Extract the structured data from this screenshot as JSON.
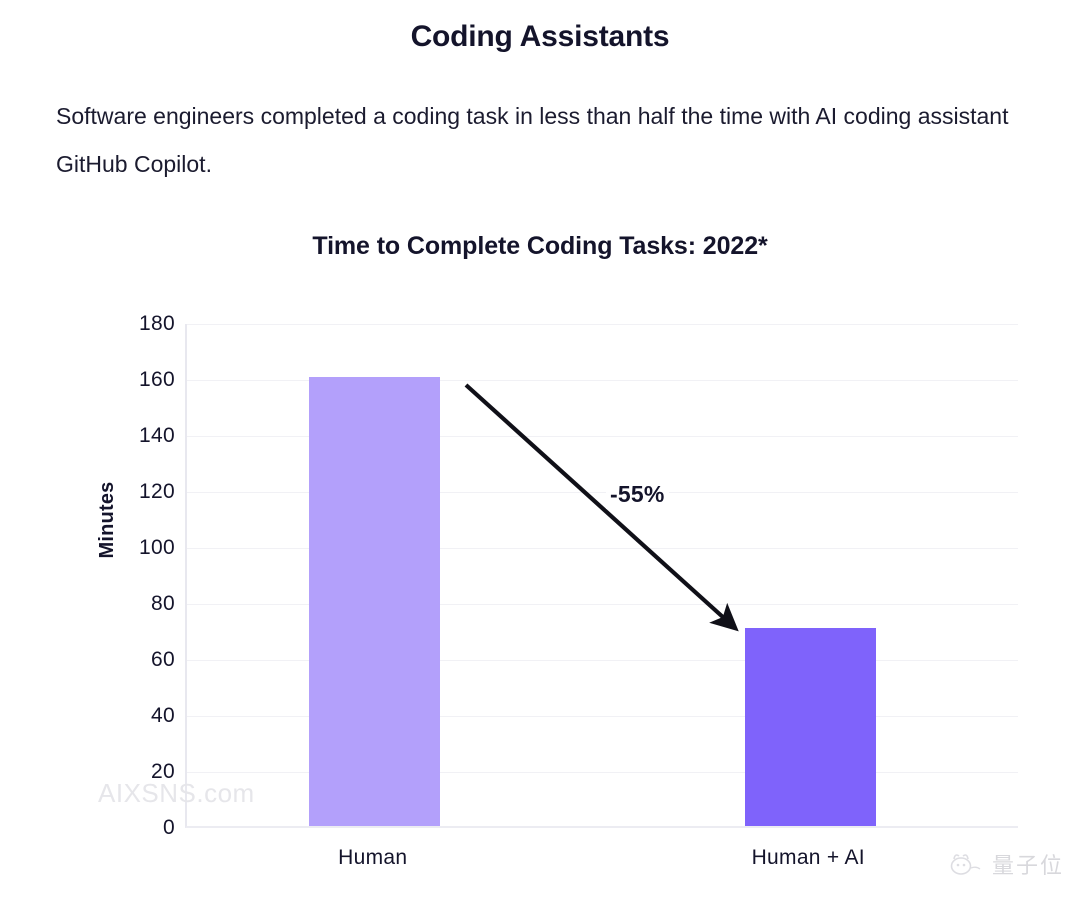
{
  "header": {
    "title": "Coding Assistants",
    "body": "Software engineers completed a coding task in less than half the time with AI coding assistant GitHub Copilot."
  },
  "watermarks": {
    "left": "AIXSNS.com",
    "right": "量子位"
  },
  "chart_data": {
    "type": "bar",
    "title": "Time to Complete Coding Tasks: 2022*",
    "xlabel": "",
    "ylabel": "Minutes",
    "categories": [
      "Human",
      "Human + AI"
    ],
    "values": [
      161,
      71
    ],
    "ylim": [
      0,
      180
    ],
    "yticks": [
      "180",
      "160",
      "140",
      "120",
      "100",
      "80",
      "60",
      "40",
      "20",
      "0"
    ],
    "ytick_values": [
      180,
      160,
      140,
      120,
      100,
      80,
      60,
      40,
      20,
      0
    ],
    "grid": true,
    "legend": "none",
    "bar_colors": [
      "#b3a0fb",
      "#7f63fb"
    ],
    "annotations": [
      {
        "text": "-55%",
        "kind": "arrow-label"
      }
    ]
  }
}
